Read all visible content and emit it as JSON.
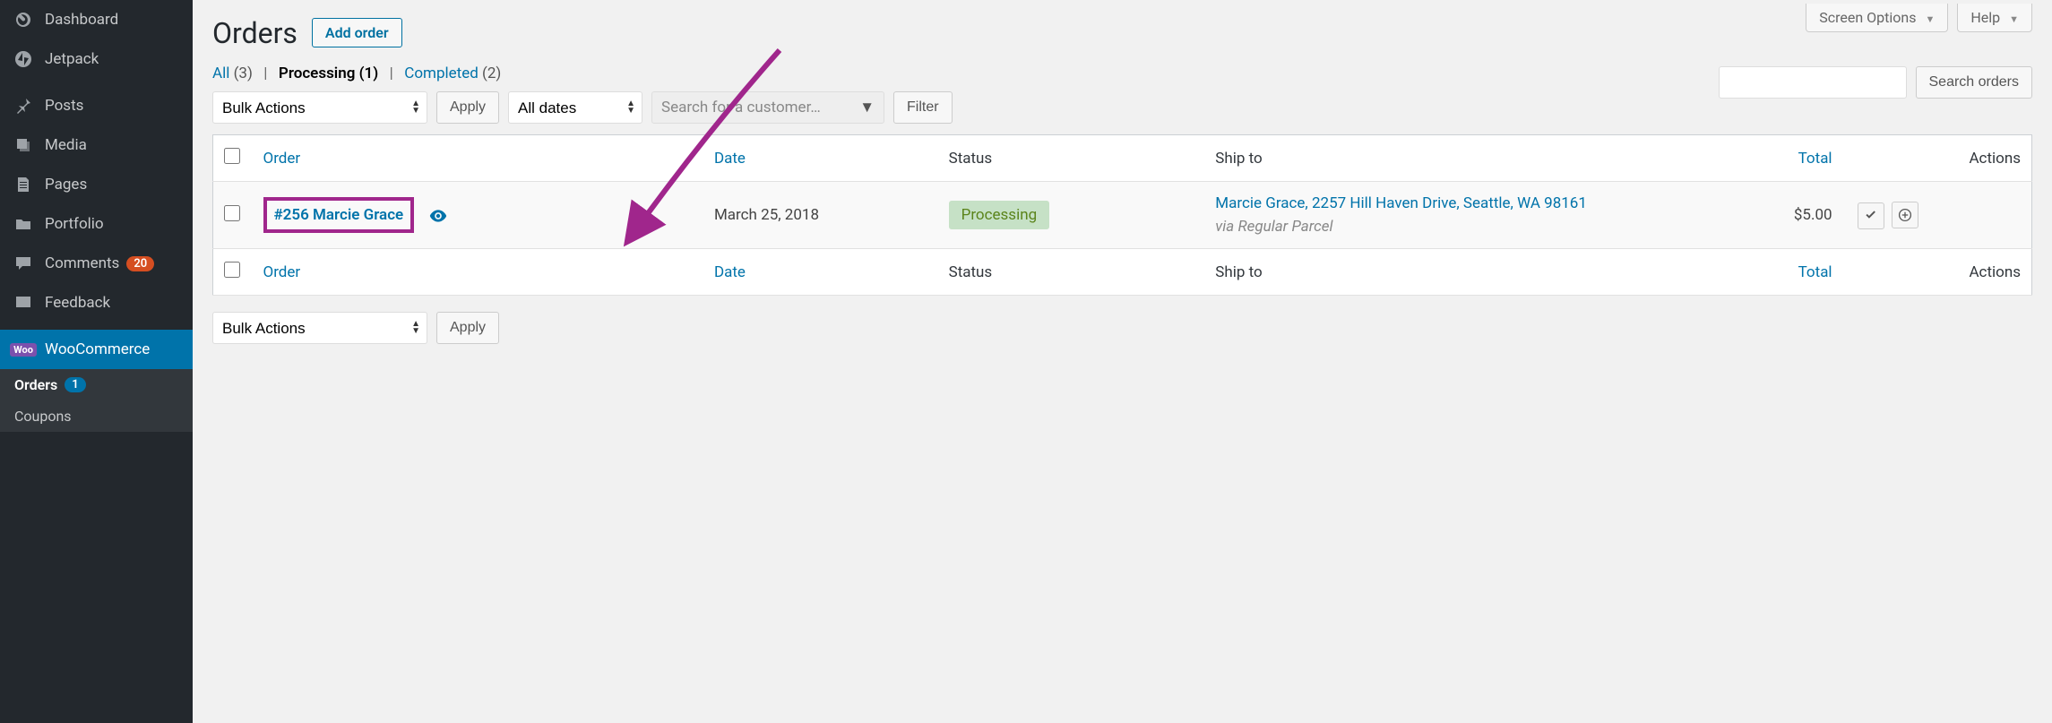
{
  "top_tabs": {
    "screen_options": "Screen Options",
    "help": "Help"
  },
  "sidebar": {
    "items": [
      {
        "label": "Dashboard"
      },
      {
        "label": "Jetpack"
      },
      {
        "label": "Posts"
      },
      {
        "label": "Media"
      },
      {
        "label": "Pages"
      },
      {
        "label": "Portfolio"
      },
      {
        "label": "Comments",
        "badge": "20"
      },
      {
        "label": "Feedback"
      },
      {
        "label": "WooCommerce",
        "woo": "Woo"
      }
    ],
    "sub": [
      {
        "label": "Orders",
        "badge": "1"
      },
      {
        "label": "Coupons"
      }
    ]
  },
  "page": {
    "title": "Orders",
    "add_button": "Add order"
  },
  "subsubsub": {
    "all": {
      "label": "All",
      "count": "(3)"
    },
    "processing": {
      "label": "Processing",
      "count": "(1)"
    },
    "completed": {
      "label": "Completed",
      "count": "(2)"
    }
  },
  "filters": {
    "bulk_actions": "Bulk Actions",
    "apply": "Apply",
    "all_dates": "All dates",
    "customer_placeholder": "Search for a customer…",
    "filter": "Filter",
    "search_orders": "Search orders"
  },
  "table": {
    "headers": {
      "order": "Order",
      "date": "Date",
      "status": "Status",
      "ship_to": "Ship to",
      "total": "Total",
      "actions": "Actions"
    },
    "rows": [
      {
        "order_label": "#256 Marcie Grace",
        "date": "March 25, 2018",
        "status": "Processing",
        "ship_to": "Marcie Grace, 2257 Hill Haven Drive, Seattle, WA 98161",
        "via": "via Regular Parcel",
        "total": "$5.00"
      }
    ]
  }
}
